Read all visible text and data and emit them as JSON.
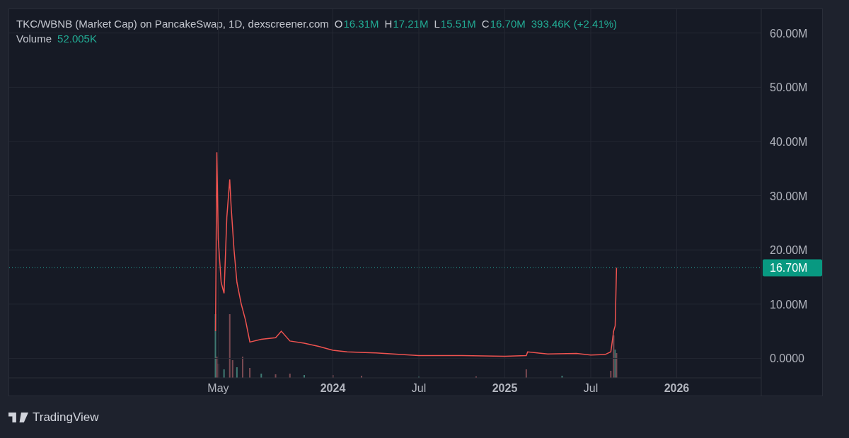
{
  "legend": {
    "title": "TKC/WBNB (Market Cap) on PancakeSwap, 1D, dexscreener.com",
    "ohlc": [
      {
        "key": "O",
        "value": "16.31M"
      },
      {
        "key": "H",
        "value": "17.21M"
      },
      {
        "key": "L",
        "value": "15.51M"
      },
      {
        "key": "C",
        "value": "16.70M"
      }
    ],
    "change": "393.46K (+2.41%)",
    "volume_label": "Volume",
    "volume_value": "52.005K"
  },
  "price_label": "16.70M",
  "chart_data": {
    "type": "line",
    "grid": true,
    "ref_lines": [
      {
        "axis": "y",
        "value": 16.7,
        "color": "#26a69a"
      }
    ],
    "ylim": [
      -3.6,
      64.4
    ],
    "xlim": [
      2022.117,
      2026.492
    ],
    "yticks": [
      {
        "value": 0,
        "label": "0.0000"
      },
      {
        "value": 10,
        "label": "10.00M"
      },
      {
        "value": 20,
        "label": "20.00M"
      },
      {
        "value": 30,
        "label": "30.00M"
      },
      {
        "value": 40,
        "label": "40.00M"
      },
      {
        "value": 50,
        "label": "50.00M"
      },
      {
        "value": 60,
        "label": "60.00M"
      }
    ],
    "xticks": [
      {
        "value": 2023.333,
        "label": "May"
      },
      {
        "value": 2024,
        "label": "2024"
      },
      {
        "value": 2024.5,
        "label": "Jul"
      },
      {
        "value": 2025,
        "label": "2025"
      },
      {
        "value": 2025.5,
        "label": "Jul"
      },
      {
        "value": 2026,
        "label": "2026"
      }
    ],
    "x": [
      2023.317,
      2023.325,
      2023.333,
      2023.35,
      2023.367,
      2023.383,
      2023.4,
      2023.408,
      2023.425,
      2023.442,
      2023.467,
      2023.492,
      2023.517,
      2023.583,
      2023.667,
      2023.7,
      2023.75,
      2023.833,
      2023.917,
      2024,
      2024.083,
      2024.25,
      2024.5,
      2024.75,
      2025,
      2025.125,
      2025.133,
      2025.25,
      2025.417,
      2025.5,
      2025.583,
      2025.617,
      2025.633,
      2025.642,
      2025.65
    ],
    "series": [
      {
        "color": "#ef5350",
        "values": [
          5,
          38,
          22,
          14,
          12,
          26,
          33,
          28,
          20,
          14,
          10,
          7,
          3,
          3.5,
          3.8,
          5,
          3.2,
          2.8,
          2.2,
          1.5,
          1.2,
          1.0,
          0.5,
          0.5,
          0.4,
          0.5,
          1.2,
          0.8,
          0.9,
          0.6,
          0.7,
          1.2,
          5,
          6,
          16.7
        ]
      }
    ]
  },
  "brand": "TradingView"
}
